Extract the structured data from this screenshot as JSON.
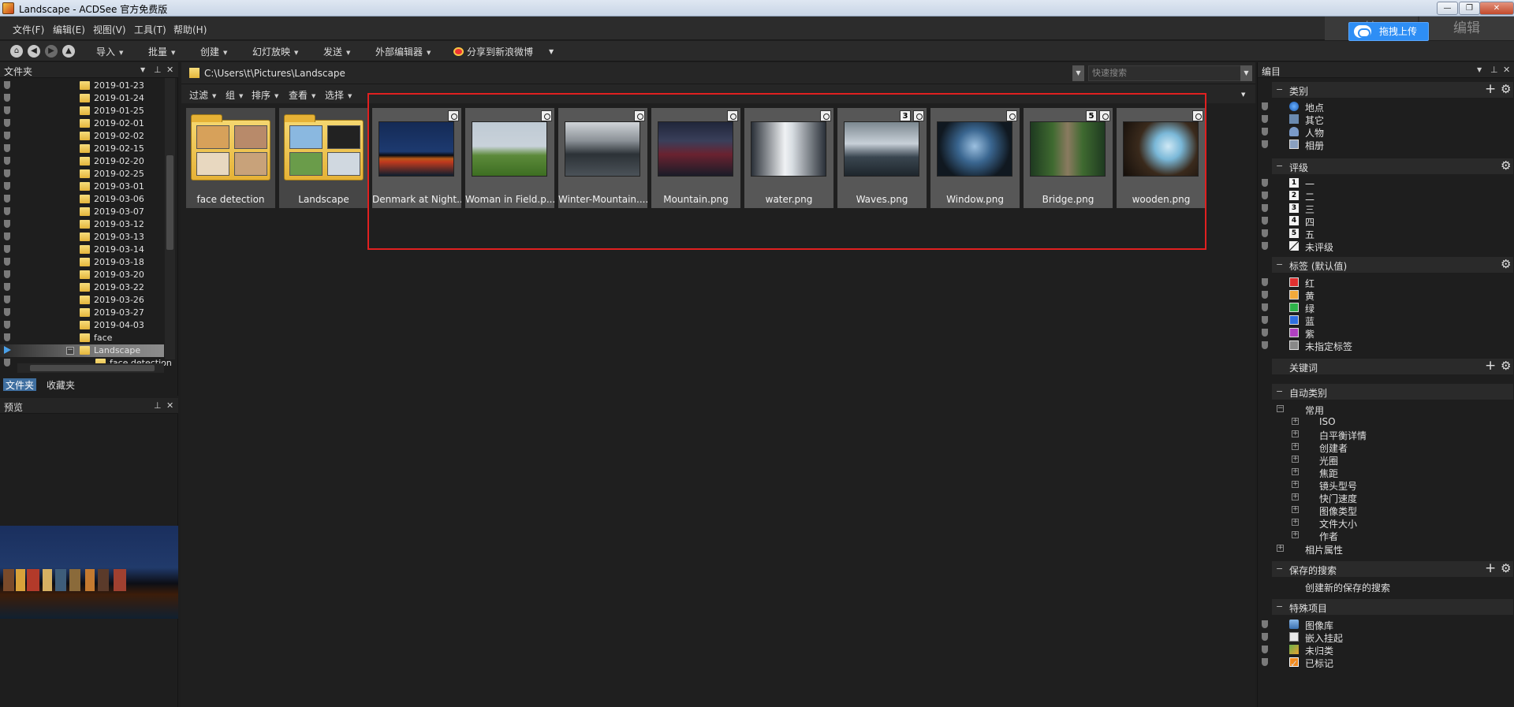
{
  "window": {
    "title": "Landscape - ACDSee 官方免费版"
  },
  "menu": [
    "文件(F)",
    "编辑(E)",
    "视图(V)",
    "工具(T)",
    "帮助(H)"
  ],
  "mode_tabs": {
    "manage": "管",
    "edit": "编辑"
  },
  "upload_button": "拖拽上传",
  "toolbar": {
    "items": [
      "导入",
      "批量",
      "创建",
      "幻灯放映",
      "发送",
      "外部编辑器"
    ],
    "weibo": "分享到新浪微博"
  },
  "folders_panel": {
    "title": "文件夹",
    "tree": [
      "2019-01-23",
      "2019-01-24",
      "2019-01-25",
      "2019-02-01",
      "2019-02-02",
      "2019-02-15",
      "2019-02-20",
      "2019-02-25",
      "2019-03-01",
      "2019-03-06",
      "2019-03-07",
      "2019-03-12",
      "2019-03-13",
      "2019-03-14",
      "2019-03-18",
      "2019-03-20",
      "2019-03-22",
      "2019-03-26",
      "2019-03-27",
      "2019-04-03",
      "face",
      "Landscape",
      "face detection"
    ],
    "tabs": [
      "文件夹",
      "收藏夹"
    ]
  },
  "preview_panel": {
    "title": "预览"
  },
  "content": {
    "path": "C:\\Users\\t\\Pictures\\Landscape",
    "quick_search_placeholder": "快速搜索",
    "filter_items": [
      "过滤",
      "组",
      "排序",
      "查看",
      "选择"
    ],
    "items": [
      {
        "name": "face detection",
        "kind": "folder",
        "rating": ""
      },
      {
        "name": "Landscape",
        "kind": "folder",
        "rating": ""
      },
      {
        "name": "Denmark at Night...",
        "kind": "image",
        "rating": ""
      },
      {
        "name": "Woman in Field.p...",
        "kind": "image",
        "rating": ""
      },
      {
        "name": "Winter-Mountain....",
        "kind": "image",
        "rating": ""
      },
      {
        "name": "Mountain.png",
        "kind": "image",
        "rating": ""
      },
      {
        "name": "water.png",
        "kind": "image",
        "rating": ""
      },
      {
        "name": "Waves.png",
        "kind": "image",
        "rating": "3"
      },
      {
        "name": "Window.png",
        "kind": "image",
        "rating": ""
      },
      {
        "name": "Bridge.png",
        "kind": "image",
        "rating": "5"
      },
      {
        "name": "wooden.png",
        "kind": "image",
        "rating": ""
      }
    ]
  },
  "organize_panel": {
    "title": "编目",
    "categories": {
      "title": "类别",
      "items": [
        "地点",
        "其它",
        "人物",
        "相册"
      ]
    },
    "ratings": {
      "title": "评级",
      "items": [
        {
          "n": "1",
          "label": "一"
        },
        {
          "n": "2",
          "label": "二"
        },
        {
          "n": "3",
          "label": "三"
        },
        {
          "n": "4",
          "label": "四"
        },
        {
          "n": "5",
          "label": "五"
        },
        {
          "n": "",
          "label": "未评级"
        }
      ]
    },
    "labels": {
      "title": "标签 (默认值)",
      "items": [
        {
          "label": "红",
          "color": "#e03030"
        },
        {
          "label": "黄",
          "color": "#f2a93b"
        },
        {
          "label": "绿",
          "color": "#2eb24a"
        },
        {
          "label": "蓝",
          "color": "#2f6fe0"
        },
        {
          "label": "紫",
          "color": "#b040c0"
        },
        {
          "label": "未指定标签",
          "color": "#888888"
        }
      ]
    },
    "keywords": {
      "title": "关键词"
    },
    "auto_categories": {
      "title": "自动类别",
      "common": "常用",
      "items": [
        "ISO",
        "白平衡详情",
        "创建者",
        "光圈",
        "焦距",
        "镜头型号",
        "快门速度",
        "图像类型",
        "文件大小",
        "作者"
      ],
      "photo_props": "相片属性"
    },
    "saved_searches": {
      "title": "保存的搜索",
      "create": "创建新的保存的搜索"
    },
    "special_items": {
      "title": "特殊项目",
      "items": [
        "图像库",
        "嵌入挂起",
        "未归类",
        "已标记"
      ]
    }
  }
}
